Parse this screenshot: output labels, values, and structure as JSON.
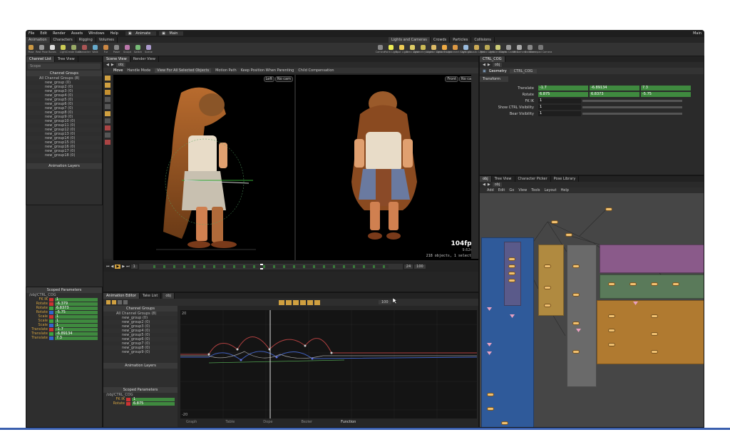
{
  "menu": [
    "File",
    "Edit",
    "Render",
    "Assets",
    "Windows",
    "Help"
  ],
  "desktop": {
    "left": "Animate",
    "center": "Main",
    "right": "Main"
  },
  "shelf_left": [
    "Animation",
    "Characters",
    "Rigging",
    "Volumes"
  ],
  "shelf_right": [
    "Lights and Cameras",
    "Crowds",
    "Particles",
    "Collisions"
  ],
  "tools_left": [
    "Pose",
    "Rest Pose",
    "Bones",
    "Light",
    "Create Bone",
    "Character",
    "Walk",
    "Fur",
    "Poser",
    "Sculpt",
    "Switch",
    "Scene"
  ],
  "tools_right": [
    "Camera",
    "Point Light",
    "Spot Light",
    "Area Light",
    "Geometry Light",
    "Volume Light",
    "Distant Light",
    "Environment Light",
    "Sky Light",
    "Caustic Light",
    "Portal Light",
    "Ambient Light",
    "Stereo Camera",
    "VR Camera",
    "Switcher",
    "Gamepad Camera"
  ],
  "left_tabs": [
    "Channel List",
    "Tree View"
  ],
  "channel_groups": {
    "header": "Channel Groups",
    "items": [
      "All Channel Groups (8)",
      "new_group (0)",
      "new_group2 (0)",
      "new_group3 (0)",
      "new_group4 (0)",
      "new_group5 (0)",
      "new_group6 (0)",
      "new_group7 (0)",
      "new_group8 (0)",
      "new_group9 (0)",
      "new_group10 (0)",
      "new_group11 (0)",
      "new_group12 (0)",
      "new_group13 (0)",
      "new_group14 (0)",
      "new_group15 (0)",
      "new_group16 (0)",
      "new_group17 (0)",
      "new_group18 (0)"
    ]
  },
  "anim_layers": "Animation Layers",
  "scoped_params": {
    "header": "Scoped Parameters",
    "path": "/obj/CTRL_COG",
    "rows": [
      {
        "label": "FK IK",
        "value": "1",
        "color": "#cc3333"
      },
      {
        "label": "Rotate",
        "value": "-6.379",
        "color": "#cc3333"
      },
      {
        "label": "Rotate",
        "value": "6.8373",
        "color": "#3fa33f"
      },
      {
        "label": "Rotate",
        "value": "-5.75",
        "color": "#3366cc"
      },
      {
        "label": "Scale",
        "value": "1",
        "color": "#cc3333"
      },
      {
        "label": "Scale",
        "value": "1",
        "color": "#3fa33f"
      },
      {
        "label": "Scale",
        "value": "1",
        "color": "#3366cc"
      },
      {
        "label": "Translate",
        "value": "-1.7",
        "color": "#cc3333"
      },
      {
        "label": "Translate",
        "value": "-6.89134",
        "color": "#3fa33f"
      },
      {
        "label": "Translate",
        "value": "7.3",
        "color": "#3366cc"
      }
    ]
  },
  "viewport": {
    "tabs": [
      "Scene View",
      "Render View"
    ],
    "path": "obj",
    "toolbar": [
      "Move",
      "Handle Mode",
      "View For All Selected Objects",
      "Motion Path",
      "Keep Position When Parenting",
      "Child Compensation"
    ],
    "left_cam": "Left",
    "left_lens": "No cam",
    "right_cam": "Front",
    "right_lens": "No cam",
    "fps": "104fps",
    "fps_sub": "9.62ms",
    "status": "218 objects, 1 selected"
  },
  "timeline": {
    "start": "1",
    "end": "48",
    "frame": "24",
    "range_start": "1",
    "range_end": "48",
    "end_frame": "100"
  },
  "anim_editor": {
    "tabs": [
      "Animation Editor",
      "Take List"
    ],
    "path": "obj",
    "groups_header": "Channel Groups",
    "groups": [
      "All Channel Groups (8)",
      "new_group (0)",
      "new_group2 (0)",
      "new_group3 (0)",
      "new_group4 (0)",
      "new_group5 (0)",
      "new_group6 (0)",
      "new_group7 (0)",
      "new_group8 (0)",
      "new_group9 (0)"
    ],
    "layers": "Animation Layers",
    "scoped": "Scoped Parameters",
    "scoped_path": "/obj/CTRL_COG",
    "scoped_rows": [
      {
        "label": "FK IK",
        "value": "1"
      },
      {
        "label": "Rotate",
        "value": "6.875"
      }
    ],
    "graph_y_top": "20",
    "graph_y_bottom": "-20",
    "graph_range": "100",
    "bottom_tabs": [
      "Graph",
      "Table",
      "Dope",
      "Bezier",
      "Function"
    ]
  },
  "params": {
    "tabs": [
      "CTRL_COG"
    ],
    "path": "obj",
    "title": "Geometry",
    "node": "CTRL_COG",
    "section": "Transform",
    "rows": [
      {
        "label": "Translate",
        "v": [
          "-1.7",
          "-6.89134",
          "7.3"
        ]
      },
      {
        "label": "Rotate",
        "v": [
          "6.875",
          "6.8373",
          "-5.75"
        ]
      },
      {
        "label": "FK IK",
        "v": [
          "1"
        ]
      },
      {
        "label": "Show CTRL Visibility",
        "v": [
          "1"
        ]
      },
      {
        "label": "Bear Visibility",
        "v": [
          "1"
        ]
      }
    ]
  },
  "network": {
    "tabs": [
      "obj",
      "Tree View",
      "Character Picker",
      "Pose Library"
    ],
    "path": "obj",
    "menu": [
      "Add",
      "Edit",
      "Go",
      "View",
      "Tools",
      "Layout",
      "Help"
    ]
  }
}
